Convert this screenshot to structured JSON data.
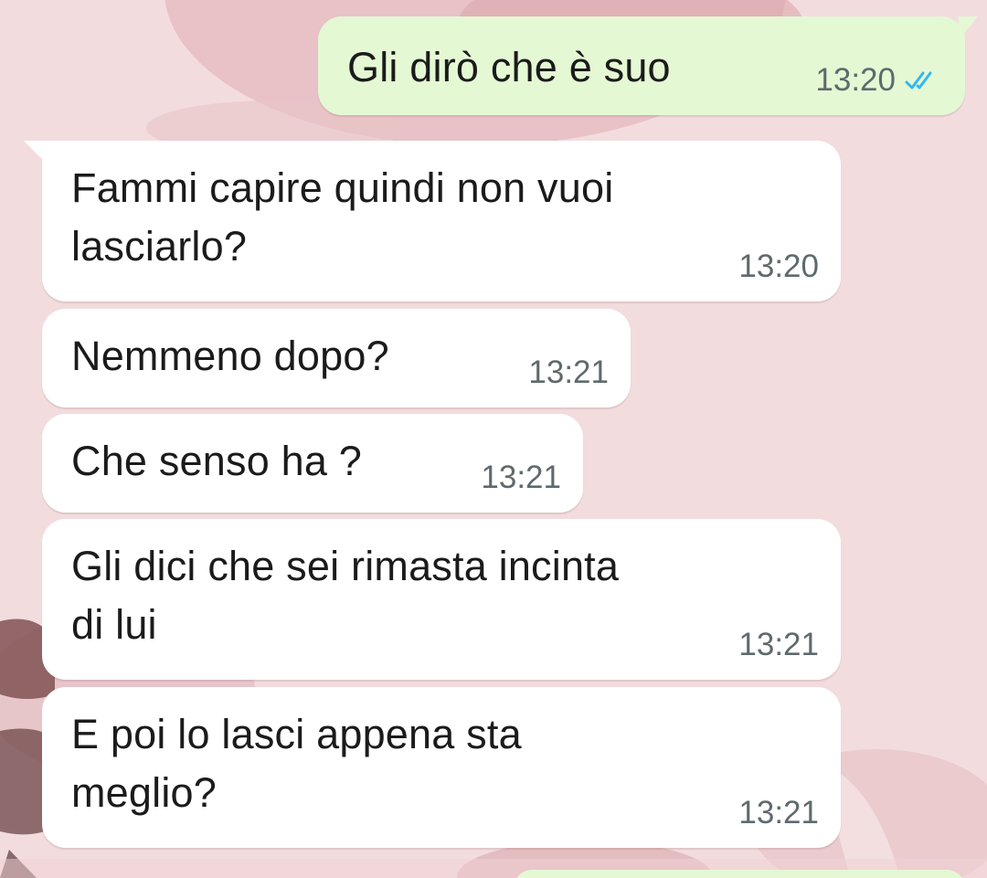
{
  "messages": [
    {
      "direction": "outgoing",
      "text": "Gli dirò che è suo",
      "time": "13:20",
      "status_icon": "double-check-read-icon",
      "status_color": "#34b7f1"
    },
    {
      "direction": "incoming",
      "text": "Fammi capire quindi non vuoi\nlasciarlo?",
      "time": "13:20"
    },
    {
      "direction": "incoming",
      "text": "Nemmeno dopo?",
      "time": "13:21"
    },
    {
      "direction": "incoming",
      "text": "Che senso ha ?",
      "time": "13:21"
    },
    {
      "direction": "incoming",
      "text": "Gli dici che sei rimasta incinta\ndi lui",
      "time": "13:21"
    },
    {
      "direction": "incoming",
      "text": "E poi lo lasci appena sta\nmeglio?",
      "time": "13:21"
    }
  ],
  "colors": {
    "wallpaper": "#f3dcde",
    "incoming_bubble": "#ffffff",
    "outgoing_bubble": "#e4f8d4",
    "timestamp": "#5f6a6e",
    "read_check": "#34b7f1"
  }
}
